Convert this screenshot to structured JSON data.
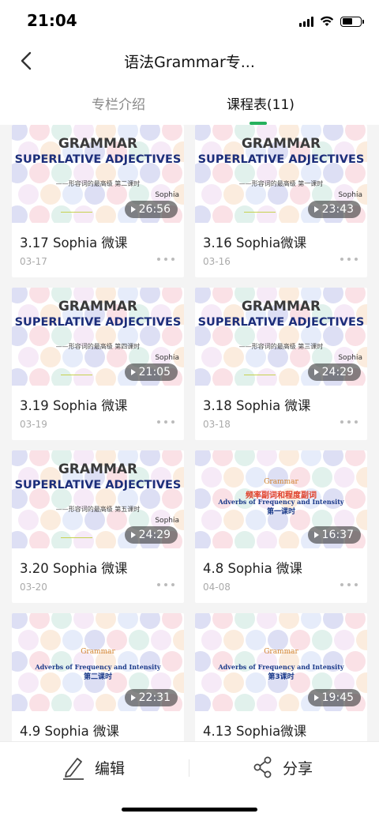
{
  "status_bar": {
    "time": "21:04",
    "icons": [
      "signal-icon",
      "wifi-icon",
      "battery-icon"
    ]
  },
  "nav": {
    "title": "语法Grammar专...",
    "back_icon": "chevron-left-icon"
  },
  "tabs": [
    {
      "label": "专栏介绍",
      "active": false
    },
    {
      "label": "课程表(11)",
      "active": true
    }
  ],
  "accent_color": "#25b15d",
  "courses": [
    {
      "title": "3.17 Sophia 微课",
      "date": "03-17",
      "duration": "26:56",
      "thumb": {
        "style": "superlative",
        "heading": "GRAMMAR",
        "subheading": "SUPERLATIVE ADJECTIVES",
        "note": "——形容词的最高级 第二课时",
        "author": "Sophia"
      }
    },
    {
      "title": "3.16 Sophia微课",
      "date": "03-16",
      "duration": "23:43",
      "thumb": {
        "style": "superlative",
        "heading": "GRAMMAR",
        "subheading": "SUPERLATIVE ADJECTIVES",
        "note": "——形容词的最高级 第一课时",
        "author": "Sophia"
      }
    },
    {
      "title": "3.19 Sophia 微课",
      "date": "03-19",
      "duration": "21:05",
      "thumb": {
        "style": "superlative",
        "heading": "GRAMMAR",
        "subheading": "SUPERLATIVE ADJECTIVES",
        "note": "——形容词的最高级 第四课时",
        "author": "Sophia"
      }
    },
    {
      "title": "3.18 Sophia 微课",
      "date": "03-18",
      "duration": "24:29",
      "thumb": {
        "style": "superlative",
        "heading": "GRAMMAR",
        "subheading": "SUPERLATIVE ADJECTIVES",
        "note": "——形容词的最高级 第三课时",
        "author": "Sophia"
      }
    },
    {
      "title": "3.20 Sophia 微课",
      "date": "03-20",
      "duration": "24:29",
      "thumb": {
        "style": "superlative",
        "heading": "GRAMMAR",
        "subheading": "SUPERLATIVE ADJECTIVES",
        "note": "——形容词的最高级 第五课时",
        "author": "Sophia"
      }
    },
    {
      "title": "4.8 Sophia 微课",
      "date": "04-08",
      "duration": "16:37",
      "thumb": {
        "style": "frequency",
        "heading": "Grammar",
        "red": "频率副词和程度副词",
        "subheading": "Adverbs of Frequency and Intensity",
        "lesson": "第一课时"
      }
    },
    {
      "title": "4.9 Sophia 微课",
      "date": "",
      "duration": "22:31",
      "thumb": {
        "style": "frequency",
        "heading": "Grammar",
        "red": "",
        "subheading": "Adverbs of Frequency and Intensity",
        "lesson": "第二课时"
      }
    },
    {
      "title": "4.13 Sophia微课",
      "date": "",
      "duration": "19:45",
      "thumb": {
        "style": "frequency",
        "heading": "Grammar",
        "red": "",
        "subheading": "Adverbs of Frequency and Intensity",
        "lesson": "第3课时"
      }
    }
  ],
  "bottom_bar": {
    "edit": {
      "label": "编辑",
      "icon": "pencil-icon"
    },
    "share": {
      "label": "分享",
      "icon": "share-icon"
    }
  }
}
